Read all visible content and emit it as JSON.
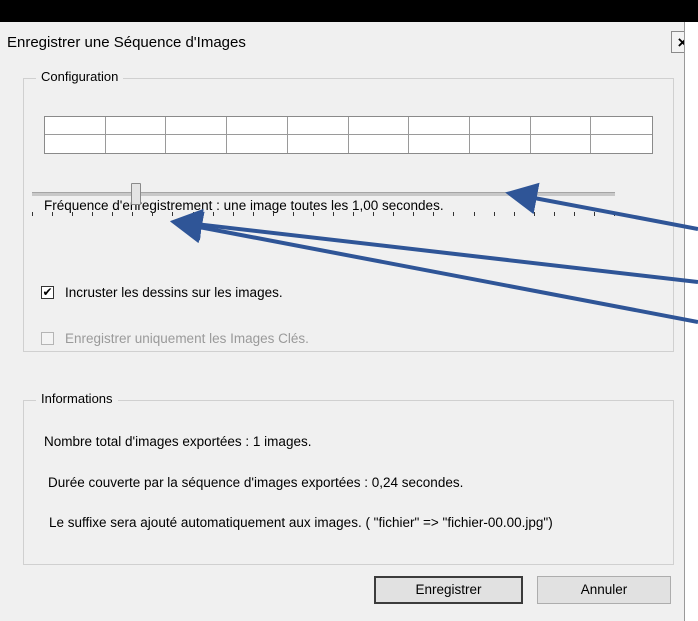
{
  "window": {
    "title": "Enregistrer une Séquence d'Images",
    "close_label": "×"
  },
  "configuration": {
    "legend": "Configuration",
    "frequency_text": "Fréquence d'enregistrement : une image toutes les 1,00 secondes.",
    "slider": {
      "value_fraction": 0.17,
      "tick_count": 30
    },
    "checkbox_overlay": {
      "label": "Incruster les dessins sur les images.",
      "checked": true,
      "mark": "✔"
    },
    "checkbox_keyframes": {
      "label": "Enregistrer uniquement les Images Clés.",
      "checked": false,
      "enabled": false
    }
  },
  "informations": {
    "legend": "Informations",
    "total_images": "Nombre total d'images exportées : 1 images.",
    "duration": "Durée couverte par la séquence d'images exportées : 0,24 secondes.",
    "suffix": "Le suffixe sera ajouté automatiquement aux images. ( \"fichier\" => \"fichier-00.00.jpg\")"
  },
  "buttons": {
    "save": "Enregistrer",
    "cancel": "Annuler"
  },
  "colors": {
    "arrow": "#2f5597",
    "window_bg": "#f0f0f0",
    "border": "#d0d0d0"
  }
}
